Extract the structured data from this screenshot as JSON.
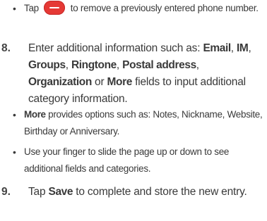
{
  "bullet_remove": {
    "prefix": "Tap",
    "icon": "remove-minus-icon",
    "suffix": "to remove a previously entered phone number."
  },
  "step8": {
    "number": "8.",
    "t1": "Enter additional information such as: ",
    "email": "Email",
    "c1": ", ",
    "im": "IM",
    "c2": ", ",
    "groups": "Groups",
    "c3": ", ",
    "ringtone": "Ringtone",
    "c4": ", ",
    "postal": "Postal address",
    "c5": ", ",
    "organization": "Organization",
    "or": " or ",
    "more": "More",
    "t2": " fields to input additional category information."
  },
  "bullet_more": {
    "more": "More",
    "text": " provides options such as: Notes, Nickname, Website, Birthday or Anniversary."
  },
  "bullet_slide": {
    "text": "Use your finger to slide the page up or down to see additional fields and categories."
  },
  "step9": {
    "number": "9.",
    "t1": "Tap ",
    "save": "Save",
    "t2": " to complete and store the new entry."
  }
}
